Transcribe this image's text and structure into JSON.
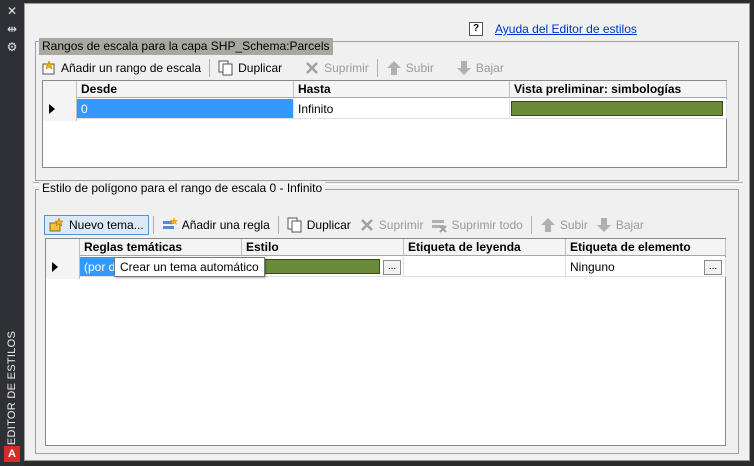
{
  "palette": {
    "close_glyph": "✕",
    "autohide_glyph": "⇹",
    "settings_glyph": "⚙",
    "title": "EDITOR DE ESTILOS",
    "app_logo": "A"
  },
  "help": {
    "icon_text": "?",
    "link_text": "Ayuda del Editor de estilos"
  },
  "scale_ranges": {
    "title": "Rangos de escala para la capa SHP_Schema:Parcels",
    "toolbar": {
      "add": "Añadir un rango de escala",
      "duplicate": "Duplicar",
      "delete": "Suprimir",
      "up": "Subir",
      "down": "Bajar"
    },
    "columns": [
      "Desde",
      "Hasta",
      "Vista preliminar: simbologías"
    ],
    "rows": [
      {
        "from": "0",
        "to": "Infinito",
        "preview_color": "#6a8c3a"
      }
    ]
  },
  "polygon_style": {
    "title": "Estilo de polígono para el rango de escala 0 - Infinito",
    "toolbar": {
      "new_theme": "Nuevo tema...",
      "add_rule": "Añadir una regla",
      "duplicate": "Duplicar",
      "delete": "Suprimir",
      "delete_all": "Suprimir todo",
      "up": "Subir",
      "down": "Bajar"
    },
    "columns": [
      "Reglas temáticas",
      "Estilo",
      "Etiqueta de leyenda",
      "Etiqueta de elemento"
    ],
    "rows": [
      {
        "rule": "(por d",
        "style_color": "#6a8c3a",
        "legend_label": "",
        "element_label": "Ninguno"
      }
    ],
    "ellipsis": "..."
  },
  "tooltip": "Crear un tema automático"
}
